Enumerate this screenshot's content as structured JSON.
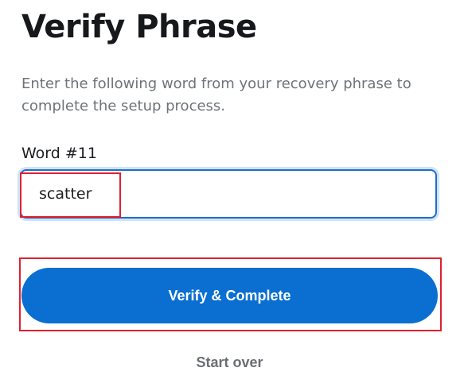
{
  "title": "Verify Phrase",
  "description": "Enter the following word from your recovery phrase to complete the setup process.",
  "word_field": {
    "label": "Word #11",
    "value": "scatter"
  },
  "actions": {
    "verify_label": "Verify & Complete",
    "start_over_label": "Start over"
  },
  "colors": {
    "primary": "#0a6fd0",
    "focus_border": "#1c6fc8",
    "highlight": "#e0202e"
  }
}
